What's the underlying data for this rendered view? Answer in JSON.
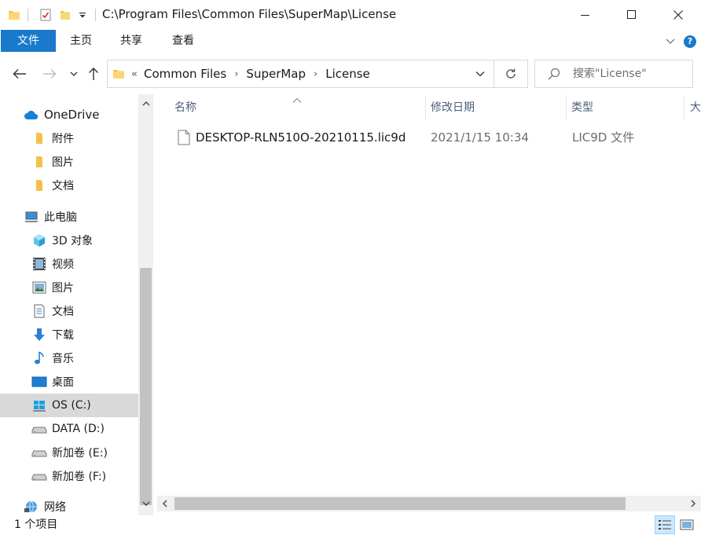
{
  "window": {
    "title": "C:\\Program Files\\Common Files\\SuperMap\\License",
    "icons": [
      "folder-icon",
      "properties-icon",
      "new-folder-icon",
      "customize-dropdown-icon"
    ],
    "controls": [
      "minimize-icon",
      "maximize-icon",
      "close-icon"
    ]
  },
  "ribbon": {
    "tabs": [
      {
        "label": "文件"
      },
      {
        "label": "主页"
      },
      {
        "label": "共享"
      },
      {
        "label": "查看"
      }
    ],
    "help": "?"
  },
  "navbar": {
    "prefix": "«",
    "breadcrumbs": [
      "Common Files",
      "SuperMap",
      "License"
    ],
    "search_placeholder": "搜索\"License\""
  },
  "sidebar": {
    "items": [
      {
        "label": "OneDrive",
        "icon": "cloud-icon"
      },
      {
        "label": "附件",
        "icon": "folder-icon"
      },
      {
        "label": "图片",
        "icon": "folder-icon"
      },
      {
        "label": "文档",
        "icon": "folder-icon"
      },
      {
        "label": "此电脑",
        "icon": "computer-icon"
      },
      {
        "label": "3D 对象",
        "icon": "cube-icon"
      },
      {
        "label": "视频",
        "icon": "video-icon"
      },
      {
        "label": "图片",
        "icon": "pictures-icon"
      },
      {
        "label": "文档",
        "icon": "documents-icon"
      },
      {
        "label": "下载",
        "icon": "download-icon"
      },
      {
        "label": "音乐",
        "icon": "music-icon"
      },
      {
        "label": "桌面",
        "icon": "desktop-icon"
      },
      {
        "label": "OS (C:)",
        "icon": "windows-drive-icon",
        "selected": true
      },
      {
        "label": "DATA (D:)",
        "icon": "drive-icon"
      },
      {
        "label": "新加卷 (E:)",
        "icon": "drive-icon"
      },
      {
        "label": "新加卷 (F:)",
        "icon": "drive-icon"
      },
      {
        "label": "网络",
        "icon": "network-icon"
      }
    ]
  },
  "columns": {
    "name": "名称",
    "modified": "修改日期",
    "type": "类型",
    "size": "大"
  },
  "files": [
    {
      "name": "DESKTOP-RLN510O-20210115.lic9d",
      "modified": "2021/1/15 10:34",
      "type": "LIC9D 文件",
      "icon": "file-icon"
    }
  ],
  "status": {
    "count_text": "1 个项目"
  },
  "colors": {
    "accent": "#1979ca",
    "selection": "#d9d9d9",
    "header_text": "#4c607a",
    "folder": "#f4c14a"
  }
}
